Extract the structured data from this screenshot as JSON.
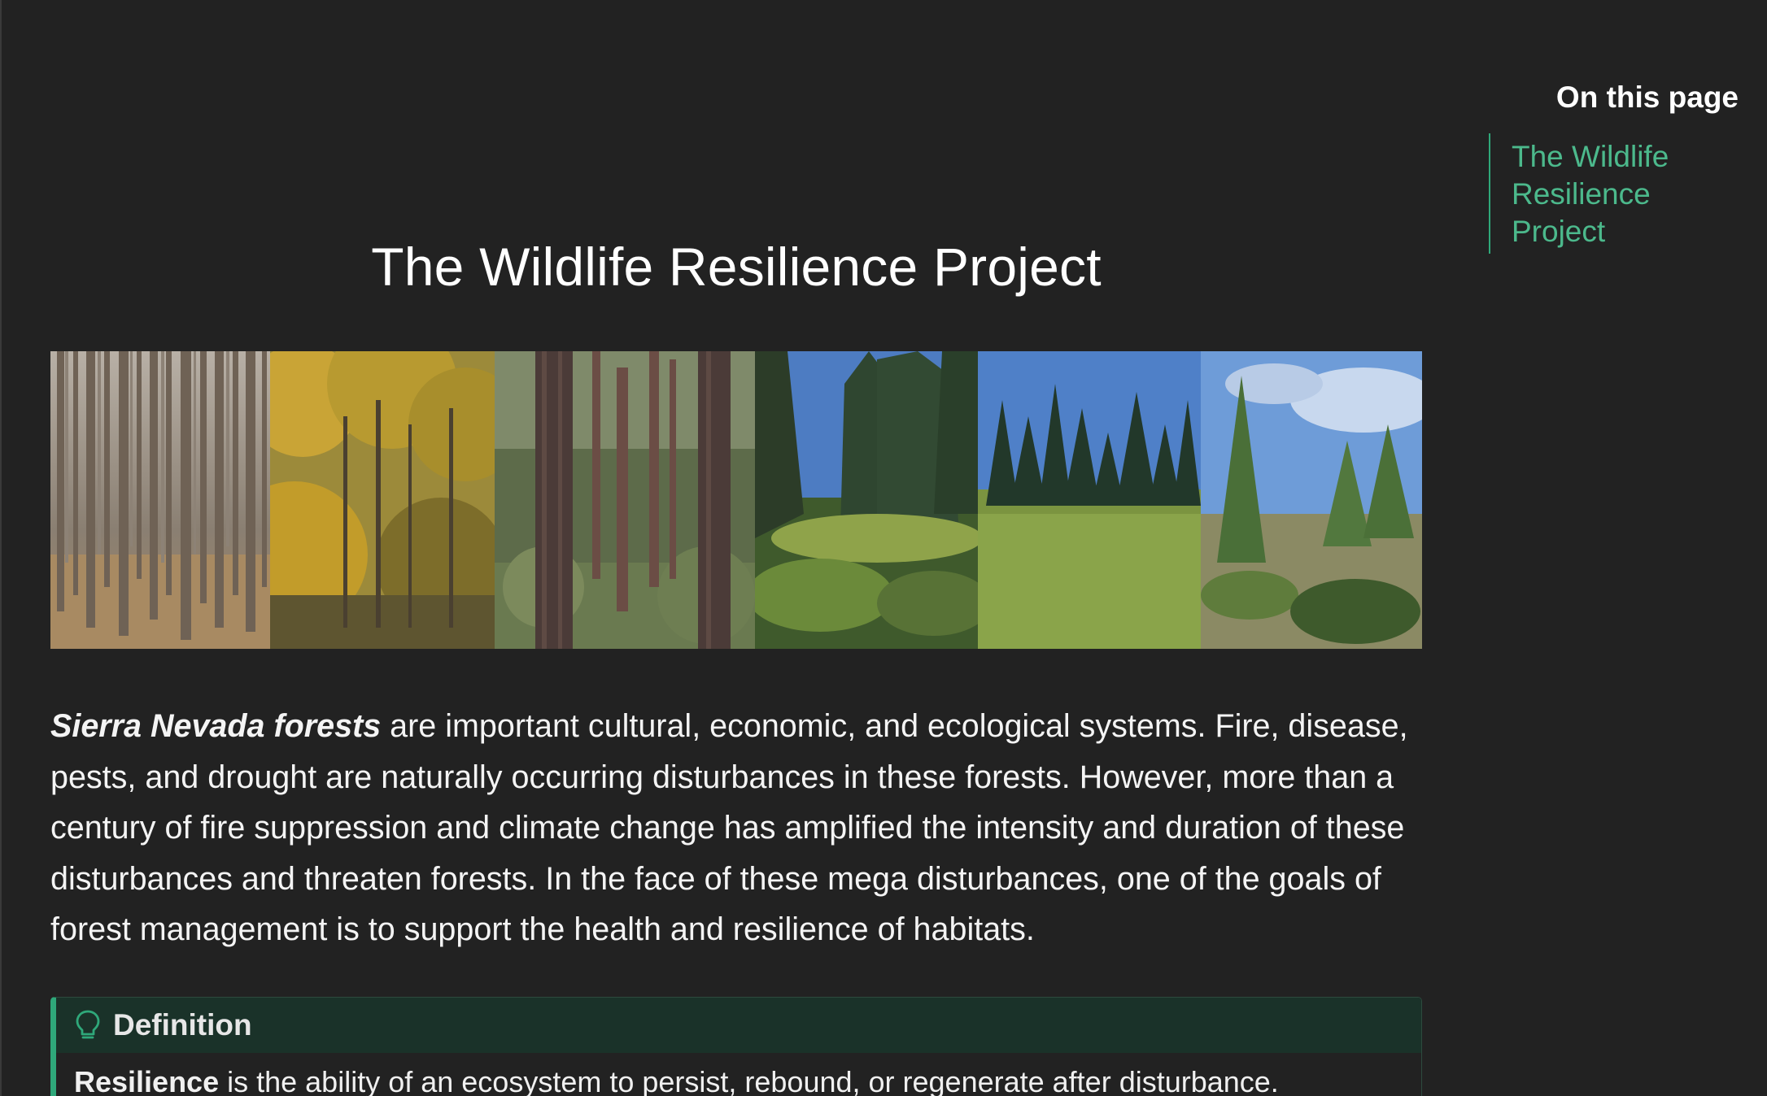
{
  "page": {
    "title": "The Wildlife Resilience Project"
  },
  "intro": {
    "emphasis": "Sierra Nevada forests",
    "text": " are important cultural, economic, and ecological systems. Fire, disease, pests, and drought are naturally occurring disturbances in these forests. However, more than a century of fire suppression and climate change has amplified the intensity and duration of these disturbances and threaten forests. In the face of these mega disturbances, one of the goals of forest management is to support the health and resilience of habitats."
  },
  "definition": {
    "icon": "lightbulb-icon",
    "title": "Definition",
    "term": "Resilience",
    "text": " is the ability of an ecosystem to persist, rebound, or regenerate after disturbance."
  },
  "toc": {
    "heading": "On this page",
    "items": [
      {
        "label_line1": "The Wildlife",
        "label_line2": "Resilience Project"
      }
    ]
  },
  "colors": {
    "background": "#222222",
    "accent": "#2fa87a",
    "link": "#4cb98c",
    "admonition_header": "#1a3229"
  }
}
